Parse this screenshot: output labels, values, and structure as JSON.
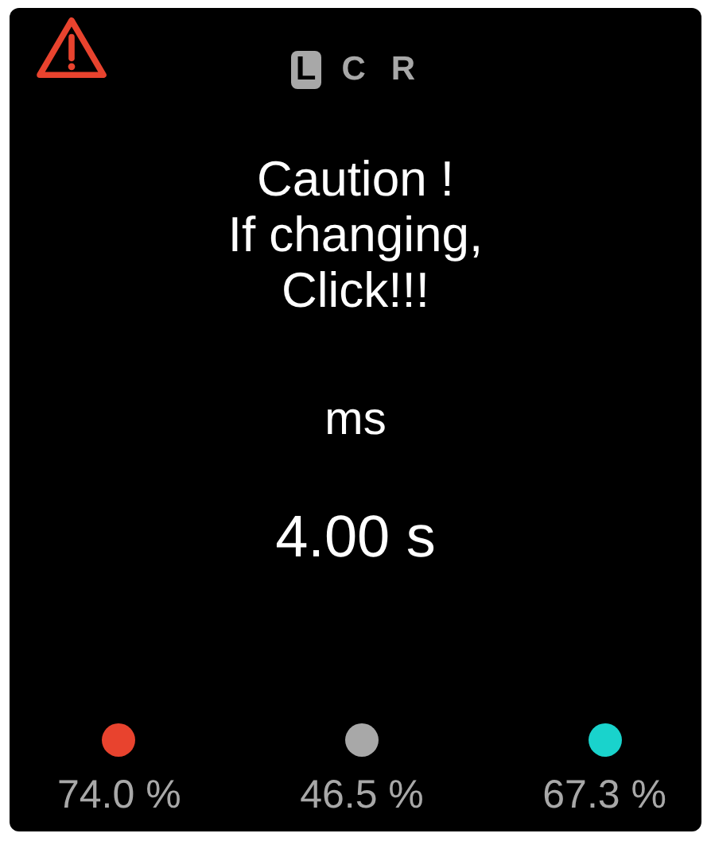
{
  "alert": {
    "kind": "warning"
  },
  "channels": [
    {
      "label": "L",
      "selected": true
    },
    {
      "label": "C",
      "selected": false
    },
    {
      "label": "R",
      "selected": false
    }
  ],
  "message": [
    "Caution !",
    "If changing,",
    "Click!!!"
  ],
  "unit": "ms",
  "value": "4.00 s",
  "meters": [
    {
      "color": "#e8432e",
      "reading": "74.0 %"
    },
    {
      "color": "#a8a8a8",
      "reading": "46.5 %"
    },
    {
      "color": "#19d3cc",
      "reading": "67.3 %"
    }
  ]
}
